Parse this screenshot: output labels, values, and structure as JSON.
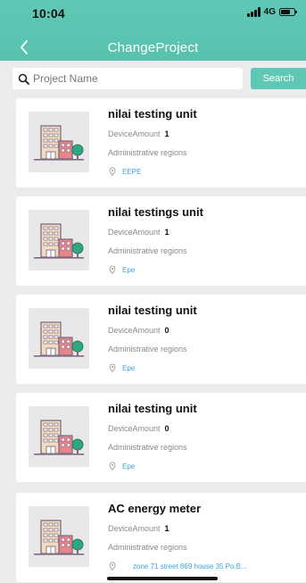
{
  "status_bar": {
    "time": "10:04",
    "network": "4G",
    "icons": [
      "signal-icon",
      "battery-icon"
    ]
  },
  "nav": {
    "title": "ChangeProject",
    "back_icon": "chevron-left-icon"
  },
  "search": {
    "placeholder": "Project Name",
    "value": "",
    "button_label": "Search"
  },
  "colors": {
    "header": "#5fc6b2",
    "search_button": "#5fc8b4",
    "location_text": "#3aa3e0",
    "background": "#ececec"
  },
  "projects": [
    {
      "title": "nilai testing unit",
      "device_label": "DeviceAmount",
      "device_count": "1",
      "admin_label": "Administrative regions",
      "location": "EEPE"
    },
    {
      "title": "nilai testings unit",
      "device_label": "DeviceAmount",
      "device_count": "1",
      "admin_label": "Administrative regions",
      "location": "Epe"
    },
    {
      "title": "nilai testing unit",
      "device_label": "DeviceAmount",
      "device_count": "0",
      "admin_label": "Administrative regions",
      "location": "Epe"
    },
    {
      "title": "nilai testing unit",
      "device_label": "DeviceAmount",
      "device_count": "0",
      "admin_label": "Administrative regions",
      "location": "Epe"
    },
    {
      "title": "AC energy meter",
      "device_label": "DeviceAmount",
      "device_count": "1",
      "admin_label": "Administrative regions",
      "location": "zone 71 street 869 house 35 Po.B..."
    }
  ]
}
